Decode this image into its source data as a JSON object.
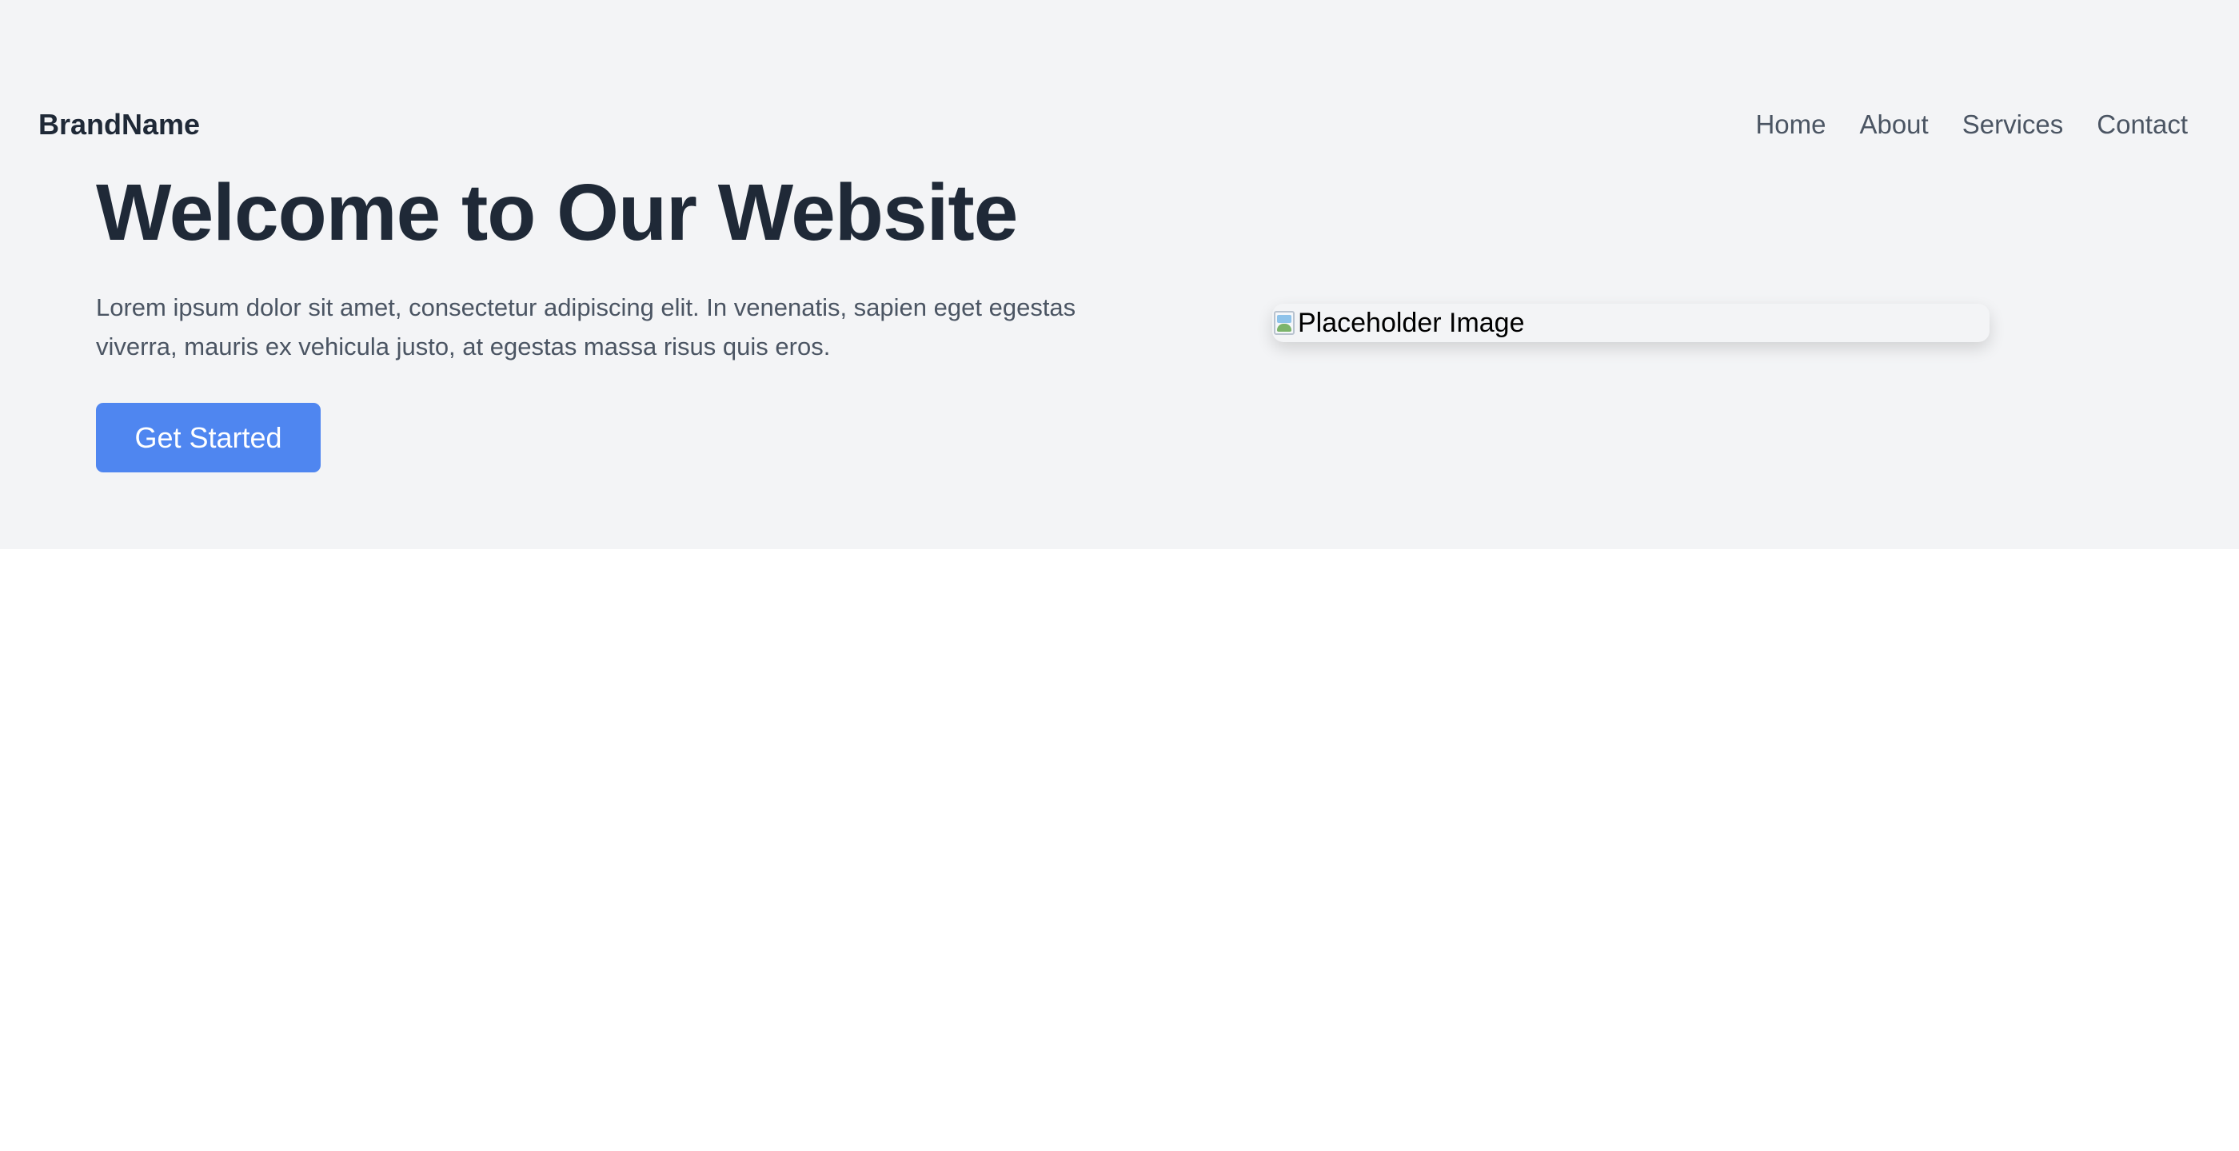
{
  "header": {
    "brand": "BrandName",
    "nav": [
      "Home",
      "About",
      "Services",
      "Contact"
    ]
  },
  "hero": {
    "title": "Welcome to Our Website",
    "description": "Lorem ipsum dolor sit amet, consectetur adipiscing elit. In venenatis, sapien eget egestas viverra, mauris ex vehicula justo, at egestas massa risus quis eros.",
    "cta_label": "Get Started",
    "image_alt": "Placeholder Image",
    "image_icon": "broken-image-icon"
  },
  "colors": {
    "hero_background": "#f3f4f6",
    "heading": "#1f2937",
    "body_text": "#4b5563",
    "button": "#4f86f0",
    "button_text": "#ffffff",
    "page_background": "#ffffff"
  }
}
